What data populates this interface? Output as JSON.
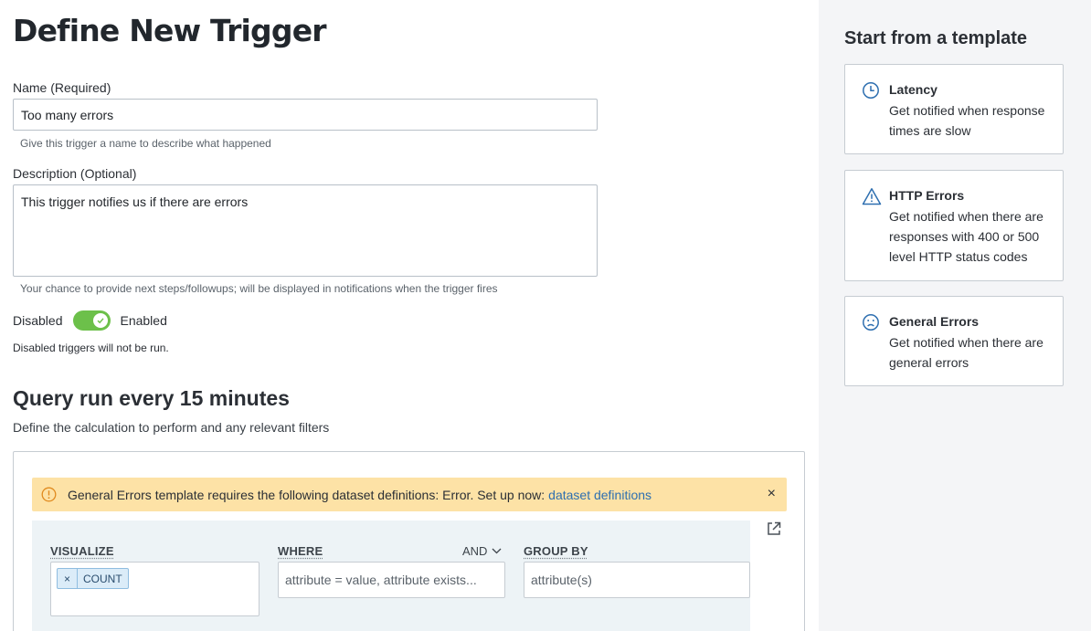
{
  "page": {
    "title": "Define New Trigger"
  },
  "form": {
    "name": {
      "label": "Name (Required)",
      "value": "Too many errors",
      "hint": "Give this trigger a name to describe what happened"
    },
    "description": {
      "label": "Description (Optional)",
      "value": "This trigger notifies us if there are errors",
      "hint": "Your chance to provide next steps/followups; will be displayed in notifications when the trigger fires"
    },
    "toggle": {
      "off_label": "Disabled",
      "on_label": "Enabled",
      "enabled": true,
      "note": "Disabled triggers will not be run."
    }
  },
  "query": {
    "title": "Query run every 15 minutes",
    "subtitle": "Define the calculation to perform and any relevant filters",
    "banner": {
      "text": "General Errors template requires the following dataset definitions: Error. Set up now:",
      "link": "dataset definitions",
      "close": "×"
    },
    "visualize": {
      "label": "VISUALIZE",
      "chips": [
        "COUNT"
      ],
      "chip_remove": "×"
    },
    "where": {
      "label": "WHERE",
      "operator": "AND",
      "placeholder": "attribute = value, attribute exists..."
    },
    "group_by": {
      "label": "GROUP BY",
      "placeholder": "attribute(s)"
    }
  },
  "sidebar": {
    "title": "Start from a template",
    "templates": [
      {
        "icon": "clock-icon",
        "title": "Latency",
        "desc": "Get notified when response times are slow"
      },
      {
        "icon": "warning-triangle-icon",
        "title": "HTTP Errors",
        "desc": "Get notified when there are responses with 400 or 500 level HTTP status codes"
      },
      {
        "icon": "sad-face-icon",
        "title": "General Errors",
        "desc": "Get notified when there are general errors"
      }
    ]
  },
  "colors": {
    "accent": "#2e6fb0",
    "toggle_on": "#6cc04a",
    "banner_bg": "#fde2a6",
    "sidebar_bg": "#f4f5f7",
    "builder_bg": "#edf3f6"
  }
}
